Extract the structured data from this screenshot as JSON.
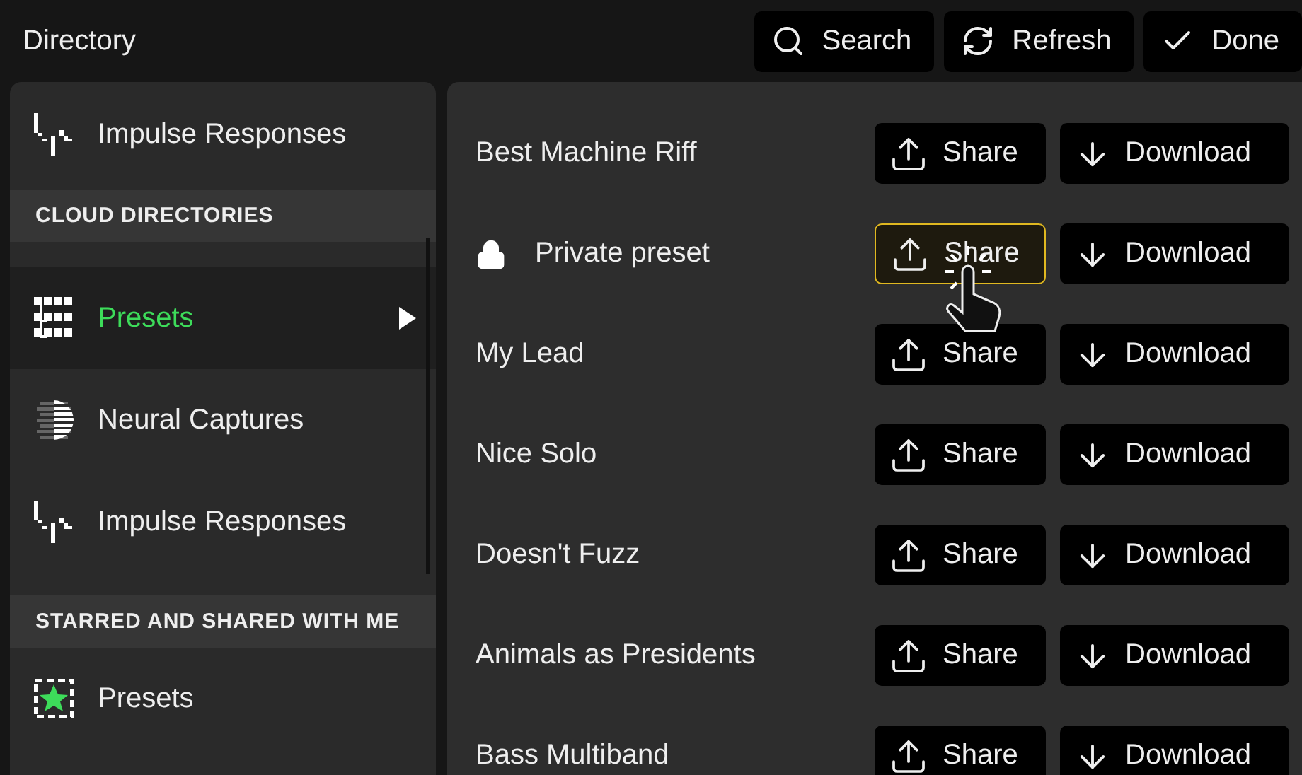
{
  "window": {
    "title": "Directory"
  },
  "toolbar": [
    {
      "kind": "search",
      "label": "Search"
    },
    {
      "kind": "refresh",
      "label": "Refresh"
    },
    {
      "kind": "done",
      "label": "Done"
    }
  ],
  "sidebar": {
    "sections": [
      {
        "items": [
          {
            "kind": "impulse",
            "label": "Impulse Responses",
            "selected": false
          }
        ]
      },
      {
        "header": "CLOUD DIRECTORIES",
        "items": [
          {
            "kind": "presets",
            "label": "Presets",
            "selected": true
          },
          {
            "kind": "neural",
            "label": "Neural Captures",
            "selected": false
          },
          {
            "kind": "impulse",
            "label": "Impulse Responses",
            "selected": false
          }
        ]
      },
      {
        "header": "STARRED AND SHARED WITH ME",
        "items": [
          {
            "kind": "starred",
            "label": "Presets",
            "selected": false
          }
        ]
      }
    ]
  },
  "presets": [
    {
      "name": "Best Machine Riff",
      "locked": false,
      "share": "Share",
      "share_highlighted": false,
      "download": "Download"
    },
    {
      "name": "Private preset",
      "locked": true,
      "share": "Share",
      "share_highlighted": true,
      "download": "Download"
    },
    {
      "name": "My Lead",
      "locked": false,
      "share": "Share",
      "share_highlighted": false,
      "download": "Download"
    },
    {
      "name": "Nice Solo",
      "locked": false,
      "share": "Share",
      "share_highlighted": false,
      "download": "Download"
    },
    {
      "name": "Doesn't Fuzz",
      "locked": false,
      "share": "Share",
      "share_highlighted": false,
      "download": "Download"
    },
    {
      "name": "Animals as Presidents",
      "locked": false,
      "share": "Share",
      "share_highlighted": false,
      "download": "Download"
    },
    {
      "name": "Bass Multiband",
      "locked": false,
      "share": "Share",
      "share_highlighted": false,
      "download": "Download"
    }
  ]
}
